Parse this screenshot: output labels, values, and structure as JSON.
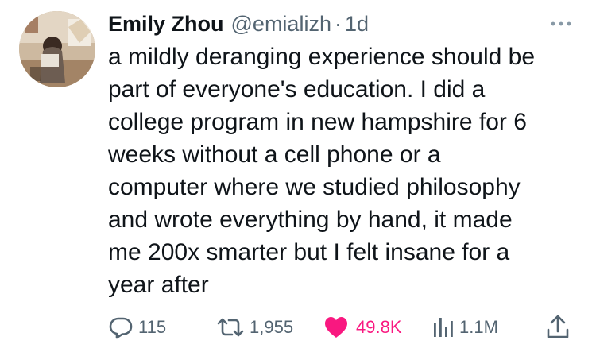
{
  "author": {
    "display_name": "Emily Zhou",
    "handle": "@emializh",
    "separator": "·",
    "timestamp": "1d",
    "avatar_icon": "profile-photo"
  },
  "more_icon": "more-horizontal-icon",
  "tweet_text_lines": [
    "a mildly deranging experience should be",
    "part of everyone's education. I did a",
    "college program in new hampshire for 6",
    "weeks without a cell phone or a",
    "computer where we studied philosophy",
    "and wrote everything by hand, it made",
    "me 200x smarter but I felt insane for a",
    "year after"
  ],
  "actions": {
    "replies": {
      "icon": "reply-icon",
      "count": "115"
    },
    "reposts": {
      "icon": "repost-icon",
      "count": "1,955"
    },
    "likes": {
      "icon": "heart-icon",
      "count": "49.8K",
      "color": "#f91880"
    },
    "views": {
      "icon": "views-icon",
      "count": "1.1M"
    },
    "share": {
      "icon": "share-icon"
    }
  },
  "colors": {
    "text_primary": "#0f1419",
    "text_secondary": "#536471",
    "like_active": "#f91880"
  }
}
